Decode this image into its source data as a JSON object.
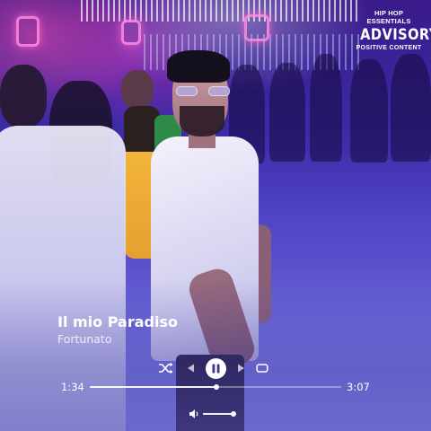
{
  "badge": {
    "top": "HIP HOP ESSENTIALS",
    "middle": "ADVISORY",
    "bottom": "POSITIVE CONTENT"
  },
  "track": {
    "title": "Il mio Paradiso",
    "artist": "Fortunato"
  },
  "playback": {
    "current_time": "1:34",
    "total_time": "3:07",
    "progress_fraction": 0.503,
    "state": "playing",
    "volume_fraction": 1.0
  },
  "icons": {
    "shuffle": "shuffle-icon",
    "previous": "previous-icon",
    "play_pause": "pause-icon",
    "next": "next-icon",
    "repeat": "repeat-icon",
    "volume": "volume-icon"
  },
  "colors": {
    "accent": "#ffffff",
    "background_tint": "#5247c9"
  }
}
